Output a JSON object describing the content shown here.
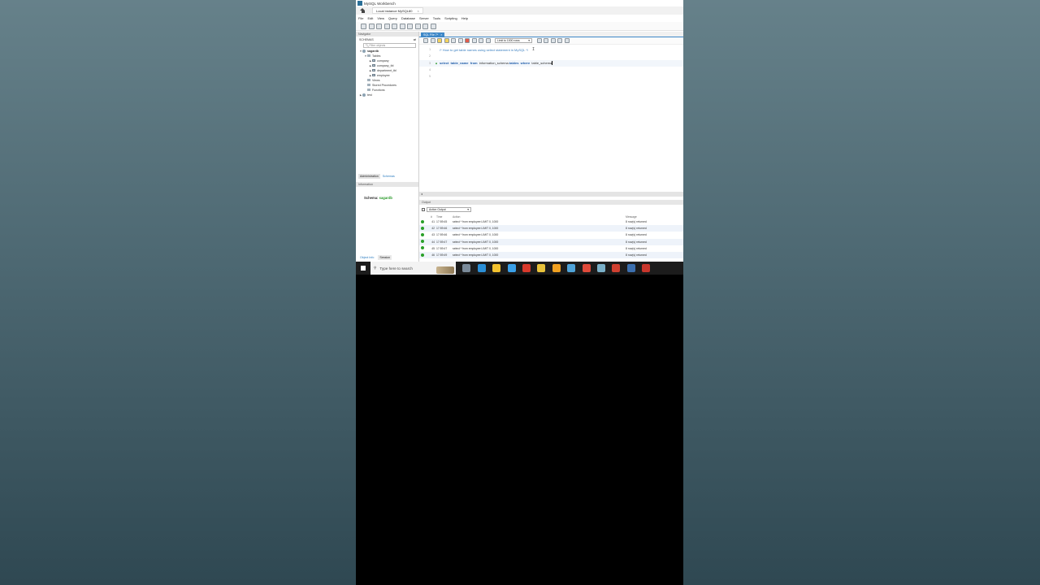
{
  "window": {
    "title": "MySQL Workbench"
  },
  "connection_tab": {
    "label": "Local instance MySQL80",
    "close": "×"
  },
  "menu": [
    "File",
    "Edit",
    "View",
    "Query",
    "Database",
    "Server",
    "Tools",
    "Scripting",
    "Help"
  ],
  "navigator": {
    "header": "Navigator",
    "schemas_label": "SCHEMAS",
    "filter_placeholder": "Filter objects",
    "tree": {
      "schema": "sagardb",
      "tables_label": "Tables",
      "tables": [
        "company",
        "company_tbl",
        "department_tbl",
        "employee"
      ],
      "views": "Views",
      "procedures": "Stored Procedures",
      "functions": "Functions",
      "other_schema": "test"
    },
    "tabs": [
      "Administration",
      "Schemas"
    ],
    "info_header": "Information",
    "schema_info_label": "Schema:",
    "schema_info_value": "sagardb",
    "bottom_tabs": [
      "Object Info",
      "Session"
    ]
  },
  "editor": {
    "tab_label": "SQL File 7*",
    "tab_close": "×",
    "limit_select": "Limit to 1000 rows",
    "lines": {
      "n1": "1",
      "n2": "2",
      "n3": "3",
      "n4": "4",
      "n5": "5",
      "comment": "/* How to get table names using select statement in MySQL */",
      "kw_select": "select",
      "kw_table_name": "table_name",
      "kw_from": "from",
      "t_info": "information_schema.",
      "kw_tables": "tables",
      "kw_where": "where",
      "t_schema": "table_schema"
    }
  },
  "output": {
    "header": "Output",
    "action_select": "Action Output",
    "columns": [
      "#",
      "Time",
      "Action",
      "Message"
    ],
    "rows": [
      {
        "num": "41",
        "time": "17:59:45",
        "action": "select * from employee LIMIT 0, 1000",
        "message": "8 row(s) returned"
      },
      {
        "num": "42",
        "time": "17:59:46",
        "action": "select * from employee LIMIT 0, 1000",
        "message": "8 row(s) returned"
      },
      {
        "num": "43",
        "time": "17:59:46",
        "action": "select * from employee LIMIT 0, 1000",
        "message": "8 row(s) returned"
      },
      {
        "num": "44",
        "time": "17:59:47",
        "action": "select * from employee LIMIT 0, 1000",
        "message": "8 row(s) returned"
      },
      {
        "num": "45",
        "time": "17:59:47",
        "action": "select * from employee LIMIT 0, 1000",
        "message": "8 row(s) returned"
      },
      {
        "num": "46",
        "time": "17:59:49",
        "action": "select * from employee LIMIT 0, 1000",
        "message": "8 row(s) returned"
      }
    ]
  },
  "taskbar": {
    "search_placeholder": "Type here to search",
    "app_colors": [
      "#7a8a99",
      "#2b8fd6",
      "#f2c12e",
      "#3aa0e8",
      "#d8392b",
      "#e8c23a",
      "#f0a020",
      "#4fa3d8",
      "#e04a3a",
      "#7ab0c8",
      "#d04030",
      "#3c6fae",
      "#c8362c"
    ]
  }
}
